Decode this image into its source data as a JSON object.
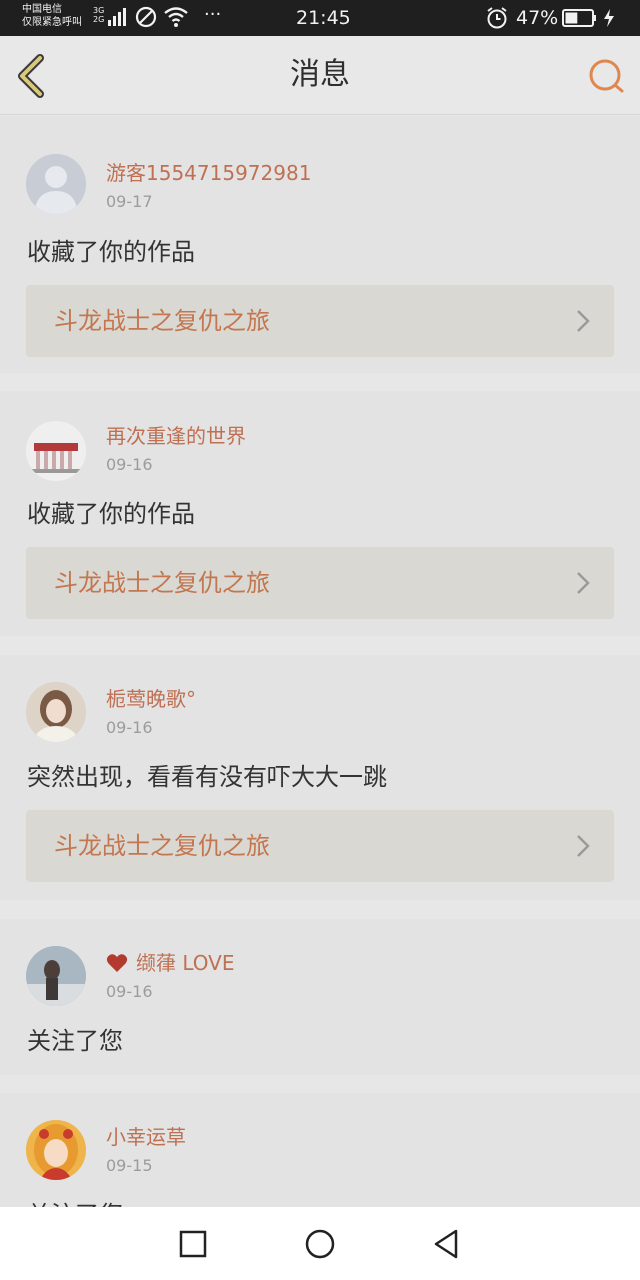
{
  "status_bar": {
    "carrier_line1": "中国电信",
    "carrier_line2": "仅限紧急呼叫",
    "net_top": "3G",
    "net_bottom": "2G",
    "more": "···",
    "time": "21:45",
    "battery_pct": "47%",
    "battery_level": 0.47,
    "icons": [
      "signal-icon",
      "do-not-disturb-icon",
      "wifi-icon",
      "alarm-icon",
      "battery-icon",
      "charging-icon"
    ]
  },
  "header": {
    "title": "消息",
    "back_icon": "chevron-left-icon",
    "search_icon": "search-icon",
    "accent": "#e0864f"
  },
  "messages": [
    {
      "user": "游客1554715972981",
      "date": "09-17",
      "action": "收藏了你的作品",
      "work": "斗龙战士之复仇之旅",
      "avatar": "default-avatar-icon"
    },
    {
      "user": "再次重逢的世界",
      "date": "09-16",
      "action": "收藏了你的作品",
      "work": "斗龙战士之复仇之旅",
      "avatar": "cake-avatar"
    },
    {
      "user": "栀莺晚歌°",
      "date": "09-16",
      "action": "突然出现，看看有没有吓大大一跳",
      "work": "斗龙战士之复仇之旅",
      "avatar": "girl-avatar"
    },
    {
      "user": "缬葎 LOVE",
      "date": "09-16",
      "action": "关注了您",
      "avatar": "photo-avatar",
      "name_icon": "heart-icon"
    },
    {
      "user": "小幸运草",
      "date": "09-15",
      "action": "关注了您",
      "avatar": "anime-avatar"
    }
  ],
  "nav_bar": {
    "icons": [
      "recent-apps-icon",
      "home-icon",
      "back-icon"
    ]
  }
}
